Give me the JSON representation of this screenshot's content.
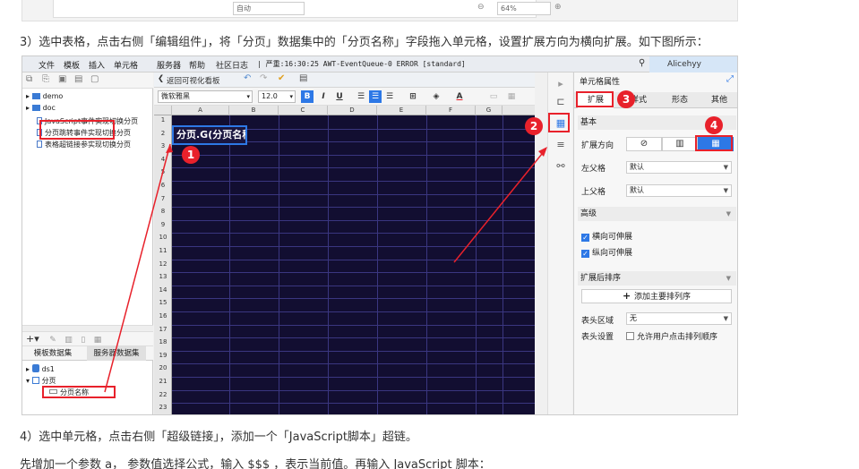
{
  "prev": {
    "select_value": "自动",
    "zoom_value": "64%"
  },
  "text": {
    "step3": "3）选中表格，点击右侧「编辑组件」，将「分页」数据集中的「分页名称」字段拖入单元格，设置扩展方向为横向扩展。如下图所示：",
    "step4": "4）选中单元格，点击右侧「超级链接」，添加一个「JavaScript脚本」超链。",
    "step5": "先增加一个参数 a， 参数值选择公式，输入 $$$ ，表示当前值。再输入 JavaScript 脚本："
  },
  "menubar": {
    "items": [
      "文件",
      "模板",
      "插入",
      "单元格",
      "服务器",
      "帮助",
      "社区日志"
    ],
    "status": "| 严重:16:30:25 AWT-EventQueue-0 ERROR [standard]",
    "user": "Alicehyy"
  },
  "tree": {
    "items": [
      "demo",
      "doc",
      "JavaScript事件实现切换分页",
      "分页跳转事件实现切换分页",
      "表格超链接参实现切换分页"
    ]
  },
  "dataset_tabs": [
    "模板数据集",
    "服务器数据集"
  ],
  "datasets": {
    "ds1": "ds1",
    "paging": "分页",
    "field": "分页名称"
  },
  "center": {
    "tab_label": "返回可视化看板",
    "font_name": "微软雅黑",
    "font_size": "12.0",
    "columns": [
      "A",
      "B",
      "C",
      "D",
      "E",
      "F",
      "G"
    ],
    "rows": [
      "1",
      "2",
      "3",
      "4",
      "5",
      "6",
      "7",
      "8",
      "9",
      "10",
      "11",
      "12",
      "13",
      "14",
      "15",
      "16",
      "17",
      "18",
      "19",
      "20",
      "21",
      "22",
      "23"
    ],
    "cell_a1": "分页.G(分页名称)"
  },
  "panel": {
    "title": "单元格属性",
    "tabs": [
      "扩展",
      "样式",
      "形态",
      "其他"
    ],
    "basic_header": "基本",
    "expand_dir_label": "扩展方向",
    "left_parent_label": "左父格",
    "left_parent_value": "默认",
    "top_parent_label": "上父格",
    "top_parent_value": "默认",
    "advanced_header": "高级",
    "horizontal_stretch": "横向可伸展",
    "vertical_stretch": "纵向可伸展",
    "sort_header": "扩展后排序",
    "add_sort_btn": "添加主要排列序",
    "header_area_label": "表头区域",
    "header_area_value": "无",
    "header_settings_label": "表头设置",
    "allow_sort_label": "允许用户点击排列顺序"
  },
  "annotations": {
    "n1": "1",
    "n2": "2",
    "n3": "3",
    "n4": "4"
  },
  "colors": {
    "accent": "#2d78e6",
    "annotation": "#e8212b",
    "grid_bg": "#120e31"
  }
}
